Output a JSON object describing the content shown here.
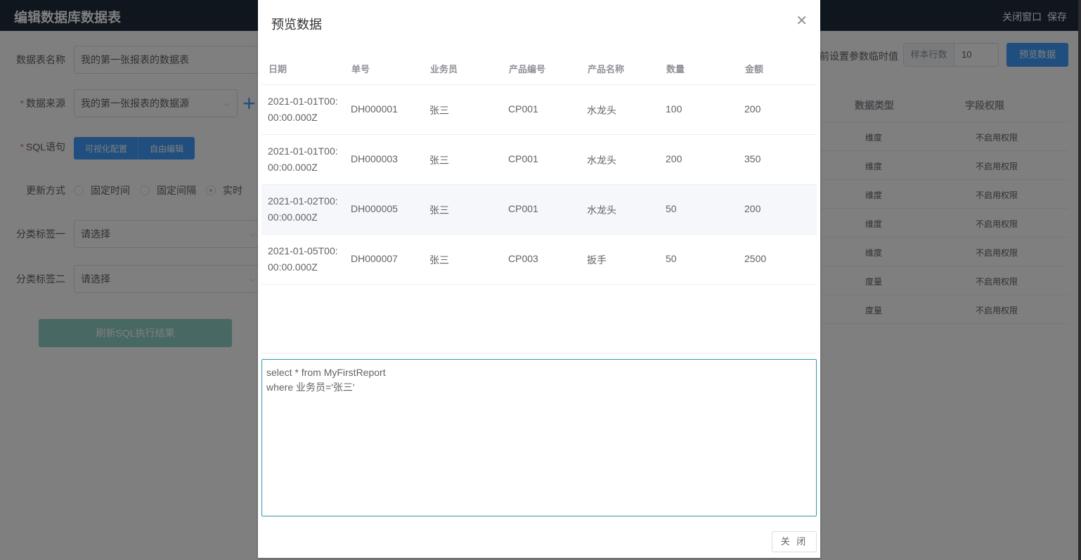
{
  "topbar": {
    "title": "编辑数据库数据表",
    "close_label": "关闭窗口",
    "save_label": "保存"
  },
  "form": {
    "table_name_label": "数据表名称",
    "table_name_value": "我的第一张报表的数据表",
    "source_label": "数据来源",
    "source_value": "我的第一张报表的数据源",
    "sql_label": "SQL语句",
    "visual_config_label": "可视化配置",
    "free_edit_label": "自由编辑",
    "update_label": "更新方式",
    "update_options": [
      "固定时间",
      "固定间隔",
      "实时"
    ],
    "tag1_label": "分类标签一",
    "tag1_placeholder": "请选择",
    "tag2_label": "分类标签二",
    "tag2_placeholder": "请选择",
    "refresh_label": "刷新SQL执行结果"
  },
  "right_panel": {
    "tip": "前设置参数临时值",
    "sample_rows_label": "样本行数",
    "sample_rows_value": "10",
    "preview_label": "预览数据",
    "columns": [
      "数据类型",
      "字段权限"
    ],
    "rows": [
      {
        "type": "维度",
        "perm": "不启用权限"
      },
      {
        "type": "维度",
        "perm": "不启用权限"
      },
      {
        "type": "维度",
        "perm": "不启用权限"
      },
      {
        "type": "维度",
        "perm": "不启用权限"
      },
      {
        "type": "维度",
        "perm": "不启用权限"
      },
      {
        "type": "度量",
        "perm": "不启用权限"
      },
      {
        "type": "度量",
        "perm": "不启用权限"
      }
    ]
  },
  "dialog": {
    "title": "预览数据",
    "columns": [
      "日期",
      "单号",
      "业务员",
      "产品编号",
      "产品名称",
      "数量",
      "金额"
    ],
    "rows": [
      {
        "date": "2021-01-01T00:00:00.000Z",
        "no": "DH000001",
        "staff": "张三",
        "code": "CP001",
        "name": "水龙头",
        "qty": "100",
        "amount": "200"
      },
      {
        "date": "2021-01-01T00:00:00.000Z",
        "no": "DH000003",
        "staff": "张三",
        "code": "CP001",
        "name": "水龙头",
        "qty": "200",
        "amount": "350"
      },
      {
        "date": "2021-01-02T00:00:00.000Z",
        "no": "DH000005",
        "staff": "张三",
        "code": "CP001",
        "name": "水龙头",
        "qty": "50",
        "amount": "200"
      },
      {
        "date": "2021-01-05T00:00:00.000Z",
        "no": "DH000007",
        "staff": "张三",
        "code": "CP003",
        "name": "扳手",
        "qty": "50",
        "amount": "2500"
      }
    ],
    "sql": "select * from MyFirstReport\nwhere 业务员='张三'",
    "close_button": "关 闭"
  }
}
